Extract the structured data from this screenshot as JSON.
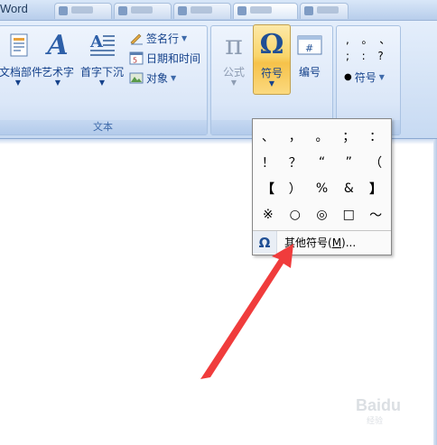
{
  "app": {
    "title_fragment": "Word"
  },
  "groups": {
    "text": {
      "label": "文本",
      "buttons": {
        "doc_parts": "文档部件",
        "wordart": "艺术字",
        "dropcap": "首字下沉",
        "signature_line": "签名行",
        "date_time": "日期和时间",
        "object": "对象"
      }
    },
    "symbols": {
      "buttons": {
        "equation": "公式",
        "symbol": "符号",
        "number": "编号"
      }
    },
    "special": {
      "glyph_row1": ",  。 、",
      "glyph_row2": ";  :  ?",
      "symbol_label": "符号"
    }
  },
  "dropdown": {
    "symbols": [
      "、",
      "，",
      "。",
      "；",
      "：",
      "！",
      "？",
      "“",
      "”",
      "（",
      "【",
      "）",
      "%",
      "&",
      "】",
      "※",
      "○",
      "◎",
      "□",
      "～"
    ],
    "more_item": {
      "icon": "Ω",
      "label_prefix": "其他符号(",
      "accelerator": "M",
      "label_suffix": ")..."
    }
  },
  "icons": {
    "pi": "π",
    "omega": "Ω",
    "wordart_glyph": "A",
    "number_glyph": "#"
  },
  "watermark": {
    "text": "Baidu",
    "sub": "经验"
  },
  "colors": {
    "annotation_arrow": "#f03c3c",
    "ribbon_text": "#15428b"
  }
}
